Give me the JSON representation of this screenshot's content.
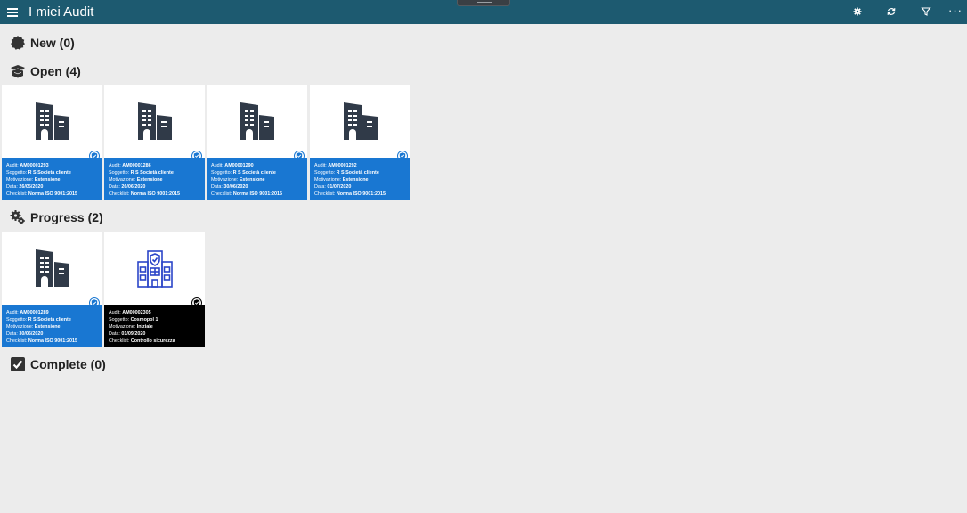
{
  "window": {
    "title": "I miei Audit"
  },
  "toolbar": {
    "more_label": "···"
  },
  "sections": [
    {
      "title": "New (0)",
      "icon": "badge-icon"
    },
    {
      "title": "Open (4)",
      "icon": "open-box-icon"
    },
    {
      "title": "Progress (2)",
      "icon": "gears-icon"
    },
    {
      "title": "Complete (0)",
      "icon": "checkbox-icon"
    }
  ],
  "field_labels": {
    "audit": "Audit:",
    "soggetto": "Soggetto:",
    "motivazione": "Motivazione:",
    "data": "Data:",
    "checklist": "Checklist:"
  },
  "cards": [
    {
      "audit": "AM00001293",
      "soggetto": "R S Società cliente",
      "motivazione": "Estensione",
      "data": "26/05/2020",
      "checklist": "Norma ISO 9001:2015",
      "image": "building-icon",
      "info_color": "#1977d2"
    },
    {
      "audit": "AM00001286",
      "soggetto": "R S Società cliente",
      "motivazione": "Estensione",
      "data": "26/06/2020",
      "checklist": "Norma ISO 9001:2015",
      "image": "building-icon",
      "info_color": "#1977d2"
    },
    {
      "audit": "AM00001290",
      "soggetto": "R S Società cliente",
      "motivazione": "Estensione",
      "data": "30/06/2020",
      "checklist": "Norma ISO 9001:2015",
      "image": "building-icon",
      "info_color": "#1977d2"
    },
    {
      "audit": "AM00001292",
      "soggetto": "R S Società cliente",
      "motivazione": "Estensione",
      "data": "01/07/2020",
      "checklist": "Norma ISO 9001:2015",
      "image": "building-icon",
      "info_color": "#1977d2"
    },
    {
      "audit": "AM00001289",
      "soggetto": "R S Società cliente",
      "motivazione": "Estensione",
      "data": "30/06/2020",
      "checklist": "Norma ISO 9001:2015",
      "image": "building-icon",
      "info_color": "#1977d2"
    },
    {
      "audit": "AM00002305",
      "soggetto": "Cosmopol 1",
      "motivazione": "Iniziale",
      "data": "01/09/2020",
      "checklist": "Controllo sicurezza",
      "image": "secure-building-icon",
      "info_color": "#000000"
    }
  ],
  "colors": {
    "titlebar": "#1d5a70",
    "background": "#ececec",
    "accent": "#1977d2",
    "dark": "#000000",
    "building": "#303a48",
    "secure_building": "#2b45c8"
  }
}
